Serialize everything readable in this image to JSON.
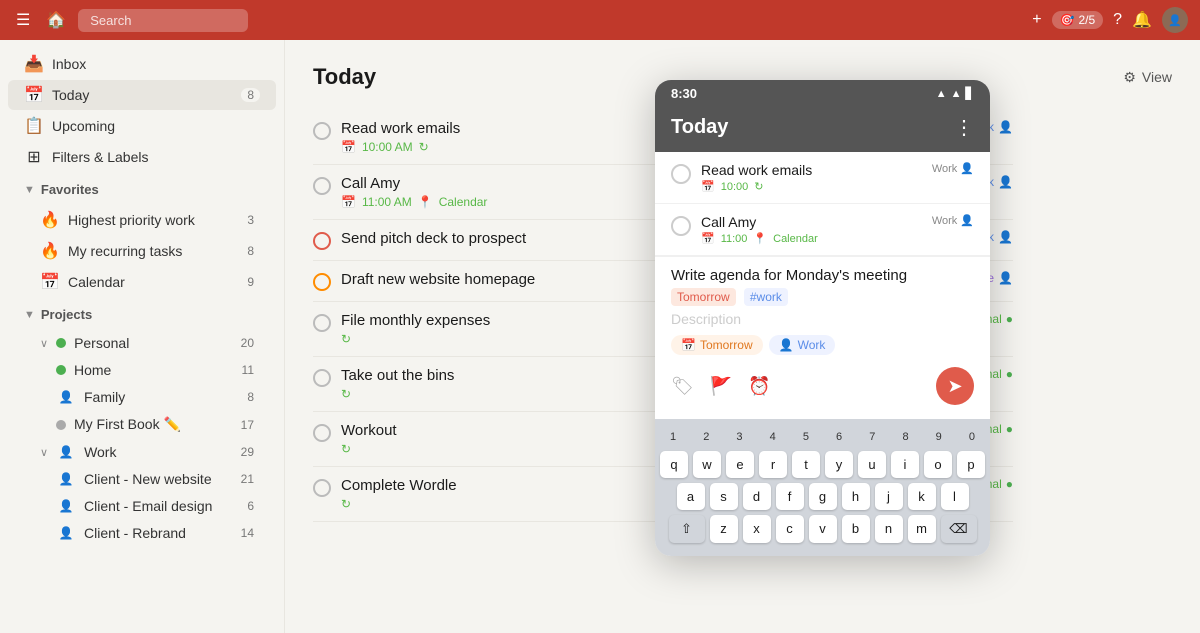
{
  "topbar": {
    "search_placeholder": "Search",
    "karma_label": "2/5",
    "add_label": "+",
    "help_label": "?",
    "bell_label": "🔔"
  },
  "sidebar": {
    "inbox_label": "Inbox",
    "today_label": "Today",
    "today_count": "8",
    "upcoming_label": "Upcoming",
    "filters_label": "Filters & Labels",
    "favorites_label": "Favorites",
    "fav_items": [
      {
        "label": "Highest priority work",
        "count": "3",
        "color": "red"
      },
      {
        "label": "My recurring tasks",
        "count": "8",
        "color": "orange"
      },
      {
        "label": "Calendar",
        "count": "9",
        "color": "gray"
      }
    ],
    "projects_label": "Projects",
    "personal_label": "Personal",
    "personal_count": "20",
    "home_label": "Home",
    "home_count": "11",
    "family_label": "Family",
    "family_count": "8",
    "mybook_label": "My First Book ✏️",
    "mybook_count": "17",
    "work_label": "Work",
    "work_count": "29",
    "client_new_label": "Client - New website",
    "client_new_count": "21",
    "client_email_label": "Client - Email design",
    "client_email_count": "6",
    "client_rebrand_label": "Client - Rebrand",
    "client_rebrand_count": "14"
  },
  "main": {
    "page_title": "Today",
    "view_label": "View",
    "tasks": [
      {
        "name": "Read work emails",
        "time": "10:00 AM",
        "has_sync": true,
        "project": "Work",
        "project_class": "work"
      },
      {
        "name": "Call Amy",
        "time": "11:00 AM",
        "has_calendar": true,
        "calendar_label": "Calendar",
        "project": "Work",
        "project_class": "work"
      },
      {
        "name": "Send pitch deck to prospect",
        "priority": "red",
        "project": "Work",
        "project_class": "work"
      },
      {
        "name": "Draft new website homepage",
        "priority": "orange",
        "project": "Client - New website",
        "project_class": "purple"
      },
      {
        "name": "File monthly expenses",
        "has_sync": true,
        "project": "Personal",
        "project_class": "personal"
      },
      {
        "name": "Take out the bins",
        "has_sync": true,
        "project": "Personal",
        "project_class": "personal"
      },
      {
        "name": "Workout",
        "has_sync": true,
        "project": "Personal",
        "project_class": "personal"
      },
      {
        "name": "Complete Wordle",
        "has_sync": true,
        "project": "Personal",
        "project_class": "personal"
      }
    ]
  },
  "mobile": {
    "time": "8:30",
    "page_title": "Today",
    "tasks": [
      {
        "name": "Read work emails",
        "time": "10:00",
        "has_sync": true,
        "project": "Work"
      },
      {
        "name": "Call Amy",
        "time": "11:00",
        "has_calendar": true,
        "calendar": "Calendar",
        "project": "Work"
      }
    ],
    "input_text": "Write agenda for Monday's meeting",
    "tag_tomorrow": "Tomorrow",
    "tag_hash_work": "#work",
    "desc_placeholder": "Description",
    "pill_tomorrow": "Tomorrow",
    "pill_work": "Work",
    "keyboard": {
      "numbers": [
        "1",
        "2",
        "3",
        "4",
        "5",
        "6",
        "7",
        "8",
        "9",
        "0"
      ],
      "row1": [
        "q",
        "w",
        "e",
        "r",
        "t",
        "y",
        "u",
        "i",
        "o",
        "p"
      ],
      "row2": [
        "a",
        "s",
        "d",
        "f",
        "g",
        "h",
        "j",
        "k",
        "l"
      ],
      "row3": [
        "z",
        "x",
        "c",
        "v",
        "b",
        "n",
        "m"
      ]
    }
  }
}
